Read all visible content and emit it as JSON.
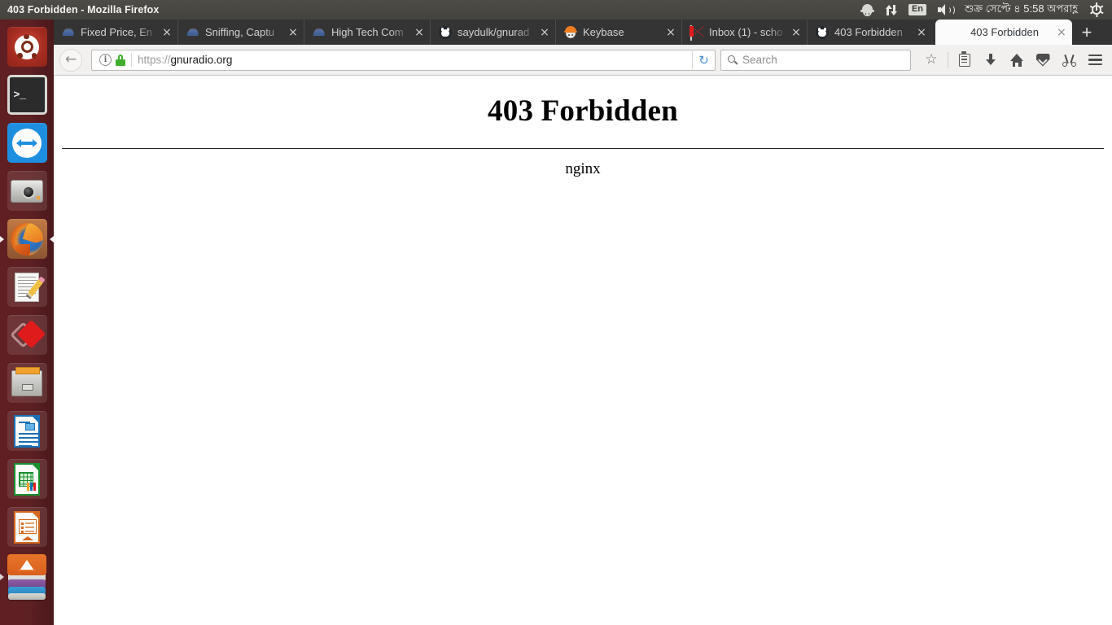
{
  "window": {
    "title": "403 Forbidden - Mozilla Firefox"
  },
  "top_panel": {
    "tray": [
      {
        "name": "keybase-tray-icon",
        "label": "Keybase"
      },
      {
        "name": "network-tray-icon",
        "label": "Network"
      },
      {
        "name": "keyboard-layout-indicator",
        "label": "En"
      },
      {
        "name": "volume-tray-icon",
        "label": "Volume"
      }
    ],
    "clock": {
      "day": "শুক্র",
      "month": "সেপ্টে",
      "date": "৪",
      "time": "5:58",
      "meridiem": "অপরাহ্ণ",
      "full": "শুক্র সেপ্টে ৪ 5:58 অপরাহ্ণ"
    },
    "session_menu": {
      "name": "session-gear-icon",
      "label": "System menu"
    }
  },
  "launcher": {
    "items": [
      {
        "name": "ubuntu-dash",
        "label": "Ubuntu Dash",
        "running": false
      },
      {
        "name": "terminal",
        "label": "Terminal",
        "running": false
      },
      {
        "name": "teamviewer",
        "label": "TeamViewer",
        "running": false
      },
      {
        "name": "camera",
        "label": "Cheese Webcam Booth",
        "running": false
      },
      {
        "name": "firefox",
        "label": "Firefox Web Browser",
        "running": true
      },
      {
        "name": "text-editor",
        "label": "Text Editor",
        "running": false
      },
      {
        "name": "red-diamond-app",
        "label": "Application",
        "running": false
      },
      {
        "name": "files",
        "label": "Files",
        "running": false
      },
      {
        "name": "libreoffice-writer",
        "label": "LibreOffice Writer",
        "running": false
      },
      {
        "name": "libreoffice-calc",
        "label": "LibreOffice Calc",
        "running": false
      },
      {
        "name": "libreoffice-impress",
        "label": "LibreOffice Impress",
        "running": false
      },
      {
        "name": "software-center",
        "label": "Ubuntu Software Center",
        "running": false
      }
    ]
  },
  "browser": {
    "tabs": [
      {
        "label": "Fixed Price, En",
        "favicon": "bird-icon",
        "active": false
      },
      {
        "label": "Sniffing, Captu",
        "favicon": "bird-icon",
        "active": false
      },
      {
        "label": "High Tech Com",
        "favicon": "bird-icon",
        "active": false
      },
      {
        "label": "saydulk/gnurad",
        "favicon": "github-icon",
        "active": false
      },
      {
        "label": "Keybase",
        "favicon": "keybase-icon",
        "active": false
      },
      {
        "label": "Inbox (1) - scho",
        "favicon": "gmail-icon",
        "active": false
      },
      {
        "label": "403 Forbidden",
        "favicon": "github-icon",
        "active": false
      },
      {
        "label": "403 Forbidden",
        "favicon": "none",
        "active": true
      }
    ],
    "close_glyph": "×",
    "newtab_glyph": "+",
    "toolbar": {
      "back_glyph": "←",
      "info_glyph": "i",
      "reload_glyph": "↻",
      "url": {
        "scheme": "https://",
        "host": "gnuradio.org"
      },
      "search_placeholder": "Search",
      "search_value": "",
      "star_glyph": "☆",
      "buttons": [
        {
          "name": "bookmark-star-button",
          "label": "Bookmark this page"
        },
        {
          "name": "library-button",
          "label": "Show your library"
        },
        {
          "name": "downloads-button",
          "label": "Downloads"
        },
        {
          "name": "home-button",
          "label": "Home"
        },
        {
          "name": "pocket-button",
          "label": "Save to Pocket"
        },
        {
          "name": "clipper-button",
          "label": "Clipper"
        },
        {
          "name": "menu-button",
          "label": "Open menu"
        }
      ]
    }
  },
  "page": {
    "heading": "403 Forbidden",
    "server": "nginx"
  }
}
